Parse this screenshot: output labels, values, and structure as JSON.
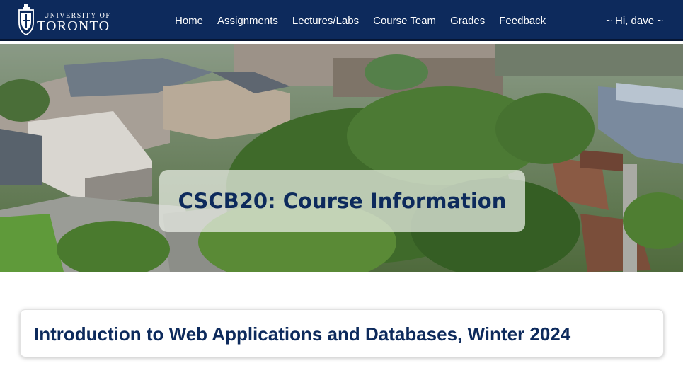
{
  "header": {
    "logo_top": "UNIVERSITY OF",
    "logo_bottom": "TORONTO",
    "nav": [
      {
        "label": "Home"
      },
      {
        "label": "Assignments"
      },
      {
        "label": "Lectures/Labs"
      },
      {
        "label": "Course Team"
      },
      {
        "label": "Grades"
      },
      {
        "label": "Feedback"
      }
    ],
    "user_greeting": "~ Hi, dave ~"
  },
  "hero": {
    "title": "CSCB20: Course Information"
  },
  "main": {
    "card_title": "Introduction to Web Applications and Databases, Winter 2024"
  },
  "colors": {
    "navbar": "#0d2a5c",
    "title_text": "#0d2a5c"
  }
}
